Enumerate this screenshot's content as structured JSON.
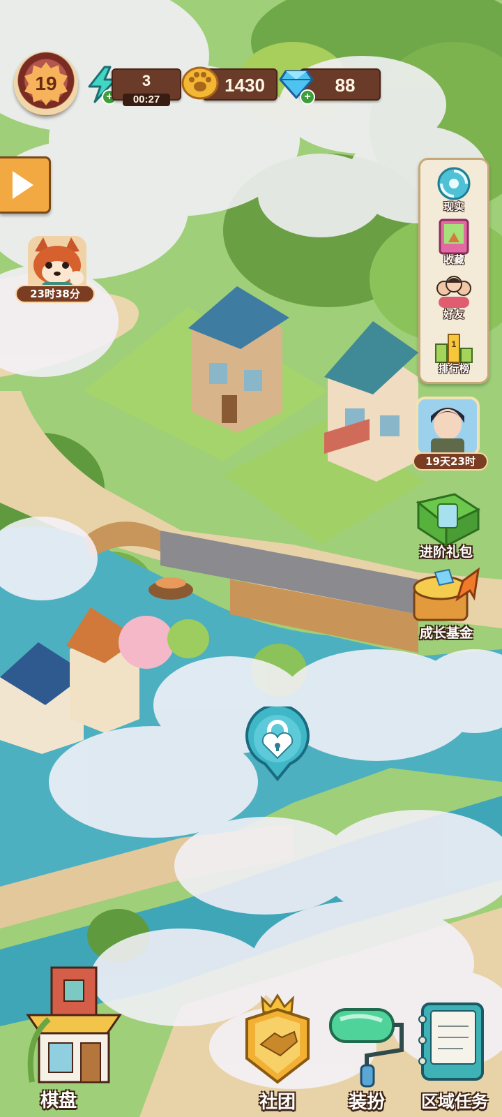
{
  "hud": {
    "level": "19",
    "energy": {
      "value": "3",
      "timer": "00:27"
    },
    "coins": "1430",
    "gems": "88"
  },
  "left_panel": {
    "event_timer": "23时38分"
  },
  "side_menu": {
    "items": [
      {
        "label": "现实",
        "icon": "portal-icon"
      },
      {
        "label": "收藏",
        "icon": "collection-book-icon"
      },
      {
        "label": "好友",
        "icon": "friends-icon"
      },
      {
        "label": "排行榜",
        "icon": "podium-icon"
      }
    ]
  },
  "promos": {
    "character_timer": "19天23时",
    "advanced_pack": "进阶礼包",
    "growth_fund": "成长基金"
  },
  "map": {
    "locked_area_icon": "heart-lock-icon"
  },
  "bottom_bar": {
    "board": "棋盘",
    "club": "社团",
    "decorate": "装扮",
    "area_tasks": "区域任务"
  },
  "colors": {
    "water": "#4db0c0",
    "grass": "#8fc56a",
    "path": "#e8d3a8",
    "hud_pill": "#6b3b2a",
    "cloud": "#f4f1f8"
  }
}
